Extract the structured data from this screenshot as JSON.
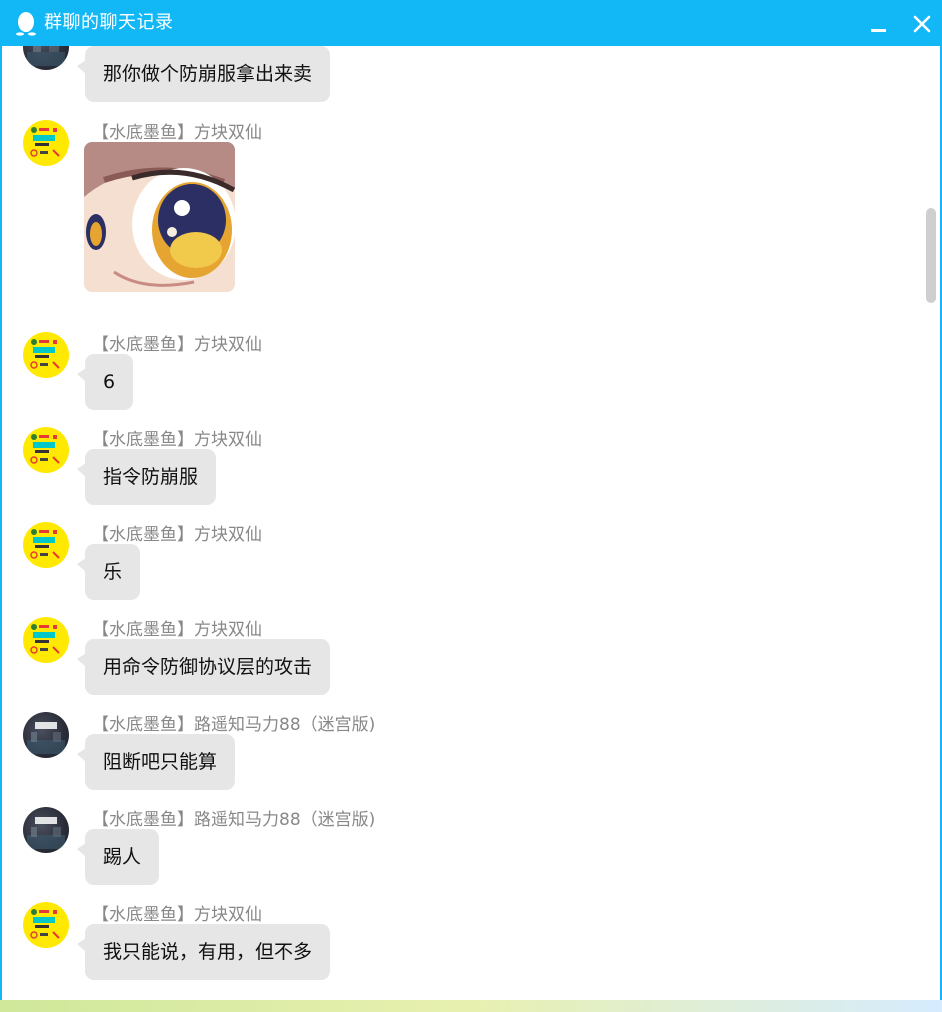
{
  "window": {
    "title": "群聊的聊天记录",
    "accent_color": "#12b7f5",
    "icons": {
      "app": "qq-penguin-icon",
      "minimize": "minimize-icon",
      "close": "close-icon"
    }
  },
  "messages": [
    {
      "sender": "",
      "text": "那你做个防崩服拿出来卖",
      "avatar": "dark"
    },
    {
      "sender": "【水底墨鱼】方块双仙",
      "text": "",
      "sticker": "anime-eye-sticker",
      "avatar": "yellow"
    },
    {
      "sender": "【水底墨鱼】方块双仙",
      "text": "6",
      "avatar": "yellow"
    },
    {
      "sender": "【水底墨鱼】方块双仙",
      "text": "指令防崩服",
      "avatar": "yellow"
    },
    {
      "sender": "【水底墨鱼】方块双仙",
      "text": "乐",
      "avatar": "yellow"
    },
    {
      "sender": "【水底墨鱼】方块双仙",
      "text": "用命令防御协议层的攻击",
      "avatar": "yellow"
    },
    {
      "sender": "【水底墨鱼】路遥知马力88（迷宫版)",
      "text": "阻断吧只能算",
      "avatar": "dark"
    },
    {
      "sender": "【水底墨鱼】路遥知马力88（迷宫版)",
      "text": "踢人",
      "avatar": "dark"
    },
    {
      "sender": "【水底墨鱼】方块双仙",
      "text": "我只能说，有用，但不多",
      "avatar": "yellow"
    }
  ]
}
